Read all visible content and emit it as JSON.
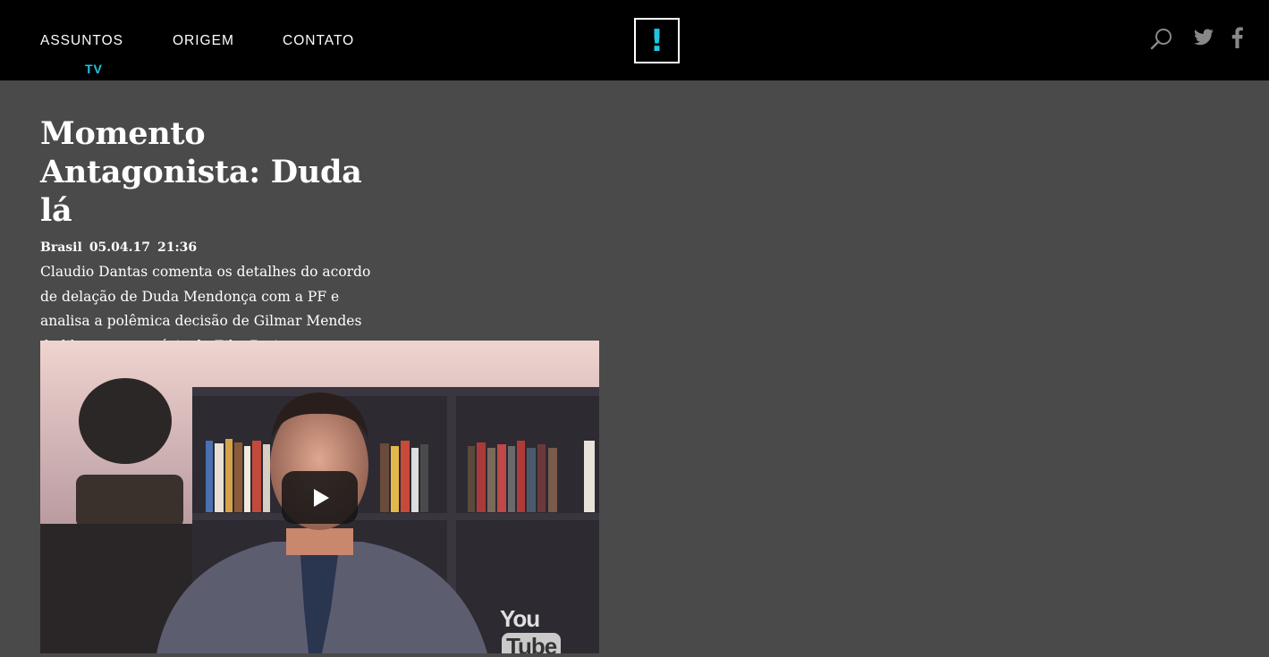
{
  "header": {
    "nav": [
      {
        "label": "ASSUNTOS"
      },
      {
        "label": "ORIGEM"
      },
      {
        "label": "CONTATO"
      }
    ],
    "sub_label": "TV",
    "logo_mark": "!",
    "accent_color": "#1fc6e0",
    "icons": [
      "search-icon",
      "twitter-icon",
      "facebook-icon"
    ]
  },
  "article": {
    "title": "Momento Antagonista: Duda lá",
    "category": "Brasil",
    "date": "05.04.17",
    "time": "21:36",
    "description": "Claudio Dantas comenta os detalhes do acordo de delação de Duda Mendonça com a PF e analisa a polêmica decisão de Gilmar Mendes de libertar o ex-sócio de Eike Batista."
  },
  "video": {
    "brand_you": "You",
    "brand_tube": "Tube",
    "play_icon": "play-icon"
  }
}
